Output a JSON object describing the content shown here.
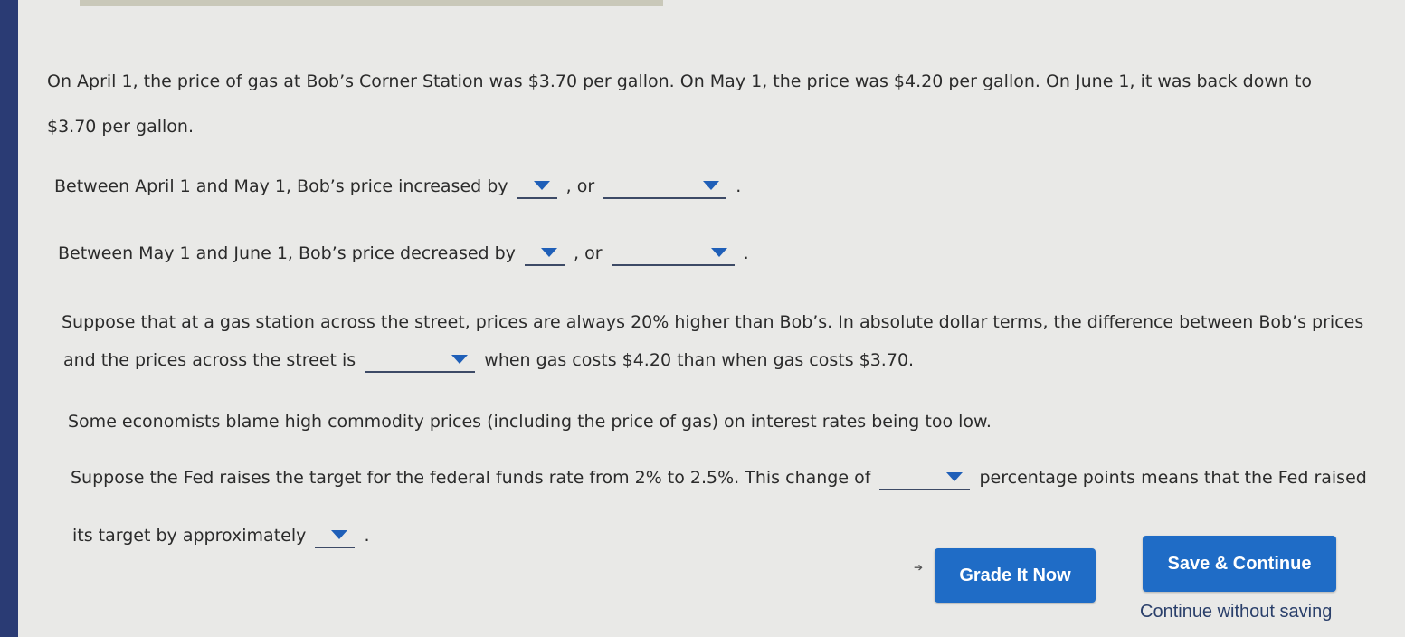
{
  "p1": {
    "line1": "On April 1, the price of gas at Bob’s Corner Station was $3.70 per gallon. On May 1, the price was $4.20 per gallon. On June 1, it was back down to",
    "line2": "$3.70 per gallon."
  },
  "p2": {
    "before": "Between April 1 and May 1, Bob’s price increased by",
    "mid": ", or",
    "end": "."
  },
  "p3": {
    "before": "Between May 1 and June 1, Bob’s price decreased by",
    "mid": ", or",
    "end": "."
  },
  "p4": {
    "line1": "Suppose that at a gas station across the street, prices are always 20% higher than Bob’s. In absolute dollar terms, the difference between Bob’s prices",
    "line2_before": "and the prices across the street is",
    "line2_after": "when gas costs $4.20 than when gas costs $3.70."
  },
  "p5": {
    "text": "Some economists blame high commodity prices (including the price of gas) on interest rates being too low."
  },
  "p6": {
    "line1_before": "Suppose the Fed raises the target for the federal funds rate from 2% to 2.5%. This change of",
    "line1_after": "percentage points means that the Fed raised",
    "line2_before": "its target by approximately",
    "line2_end": "."
  },
  "buttons": {
    "grade": "Grade It Now",
    "save": "Save & Continue",
    "continue_link": "Continue without saving"
  },
  "colors": {
    "button": "#1f6cc6",
    "dropdown_arrow": "#1f5fb8",
    "page_bg": "#e9e9e7"
  }
}
